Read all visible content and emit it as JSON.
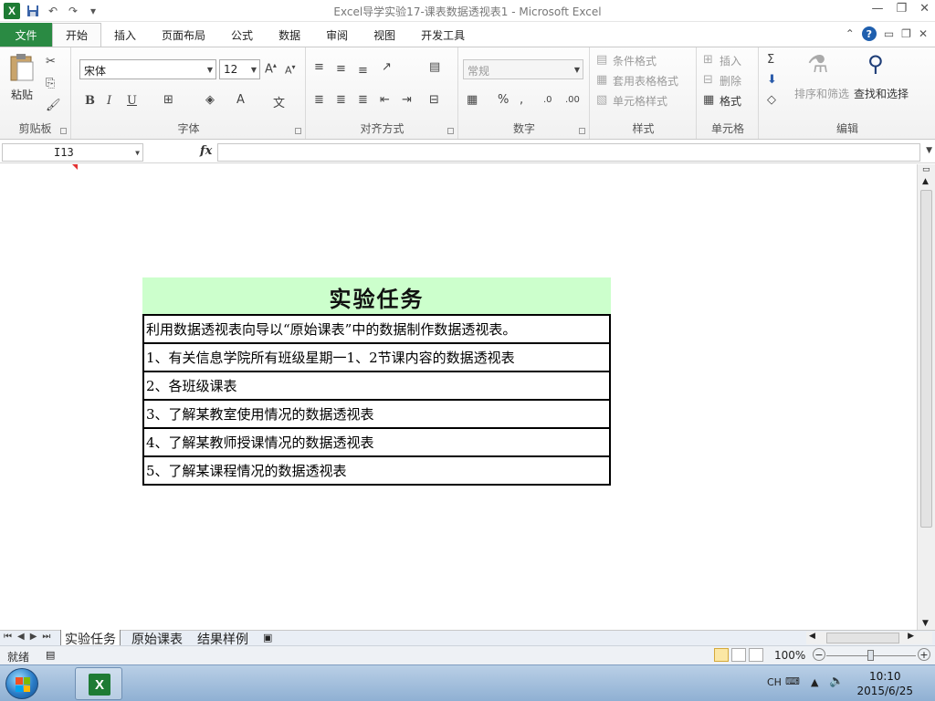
{
  "window": {
    "title": "Excel导学实验17-课表数据透视表1  -  Microsoft Excel"
  },
  "ribbon_tabs": [
    "文件",
    "开始",
    "插入",
    "页面布局",
    "公式",
    "数据",
    "审阅",
    "视图",
    "开发工具"
  ],
  "ribbon": {
    "clipboard": {
      "paste": "粘贴",
      "label": "剪贴板"
    },
    "font": {
      "name": "宋体",
      "size": "12",
      "label": "字体"
    },
    "alignment": {
      "label": "对齐方式"
    },
    "number": {
      "format": "常规",
      "label": "数字"
    },
    "styles": {
      "conditional": "条件格式",
      "table": "套用表格格式",
      "cell": "单元格样式",
      "label": "样式"
    },
    "cells": {
      "insert": "插入",
      "delete": "删除",
      "format": "格式",
      "label": "单元格"
    },
    "editing": {
      "sort": "排序和筛选",
      "find": "查找和选择",
      "label": "编辑"
    }
  },
  "formula_bar": {
    "name_box": "I13",
    "fx": "fx",
    "formula": ""
  },
  "sheet": {
    "task_title": "实验任务",
    "rows": [
      "利用数据透视表向导以“原始课表”中的数据制作数据透视表。",
      "1、有关信息学院所有班级星期一1、2节课内容的数据透视表",
      "2、各班级课表",
      "3、了解某教室使用情况的数据透视表",
      "4、了解某教师授课情况的数据透视表",
      "5、了解某课程情况的数据透视表"
    ]
  },
  "sheet_tabs": [
    "实验任务",
    "原始课表",
    "结果样例"
  ],
  "status": {
    "ready": "就绪",
    "zoom": "100%"
  },
  "taskbar": {
    "lang": "CH",
    "time": "10:10",
    "date": "2015/6/25"
  },
  "colors": {
    "file_tab": "#2a8a43",
    "task_header_bg": "#ccffcc",
    "excel_green": "#1e7b34"
  }
}
